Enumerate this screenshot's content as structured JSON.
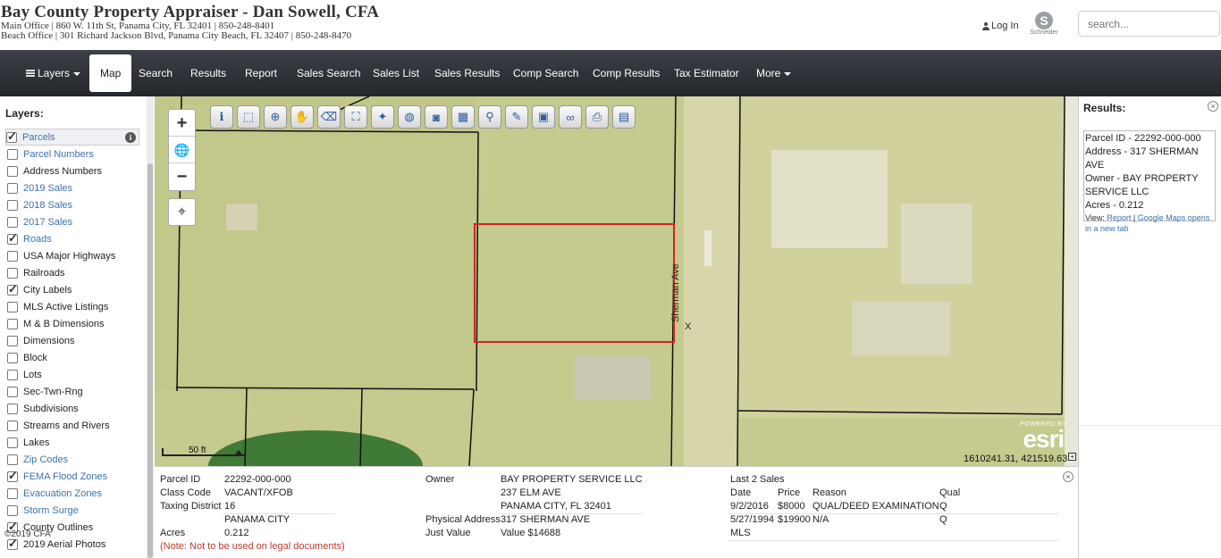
{
  "header": {
    "title": "Bay County Property Appraiser - Dan Sowell, CFA",
    "main_office": "Main Office | 860 W. 11th St, Panama City, FL 32401 | 850-248-8401",
    "beach_office": "Beach Office | 301 Richard Jackson Blvd, Panama City Beach, FL 32407 | 850-248-8470",
    "login_label": "Log In",
    "logo_letter": "S",
    "logo_text": "Schneider",
    "search_placeholder": "search..."
  },
  "nav": {
    "layers": "Layers",
    "map": "Map",
    "search": "Search",
    "results": "Results",
    "report": "Report",
    "sales_search": "Sales Search",
    "sales_list": "Sales List",
    "sales_results": "Sales Results",
    "comp_search": "Comp Search",
    "comp_results": "Comp Results",
    "tax_estimator": "Tax Estimator",
    "more": "More"
  },
  "layers_panel": {
    "title": "Layers:",
    "items": [
      {
        "label": "Parcels",
        "checked": true,
        "link": true
      },
      {
        "label": "Parcel Numbers",
        "checked": false,
        "link": true
      },
      {
        "label": "Address Numbers",
        "checked": false,
        "link": false
      },
      {
        "label": "2019 Sales",
        "checked": false,
        "link": true
      },
      {
        "label": "2018 Sales",
        "checked": false,
        "link": true
      },
      {
        "label": "2017 Sales",
        "checked": false,
        "link": true
      },
      {
        "label": "Roads",
        "checked": true,
        "link": true
      },
      {
        "label": "USA Major Highways",
        "checked": false,
        "link": false
      },
      {
        "label": "Railroads",
        "checked": false,
        "link": false
      },
      {
        "label": "City Labels",
        "checked": true,
        "link": false
      },
      {
        "label": "MLS Active Listings",
        "checked": false,
        "link": false
      },
      {
        "label": "M & B Dimensions",
        "checked": false,
        "link": false
      },
      {
        "label": "Dimensions",
        "checked": false,
        "link": false
      },
      {
        "label": "Block",
        "checked": false,
        "link": false
      },
      {
        "label": "Lots",
        "checked": false,
        "link": false
      },
      {
        "label": "Sec-Twn-Rng",
        "checked": false,
        "link": false
      },
      {
        "label": "Subdivisions",
        "checked": false,
        "link": false
      },
      {
        "label": "Streams and Rivers",
        "checked": false,
        "link": false
      },
      {
        "label": "Lakes",
        "checked": false,
        "link": false
      },
      {
        "label": "Zip Codes",
        "checked": false,
        "link": true
      },
      {
        "label": "FEMA Flood Zones",
        "checked": true,
        "link": true
      },
      {
        "label": "Evacuation Zones",
        "checked": false,
        "link": true
      },
      {
        "label": "Storm Surge",
        "checked": false,
        "link": true
      },
      {
        "label": "County Outlines",
        "checked": true,
        "link": false
      },
      {
        "label": "2019 Aerial Photos",
        "checked": true,
        "link": false
      }
    ],
    "info_glyph": "i",
    "copyright": "©2019 CFA"
  },
  "map": {
    "zoom_in": "+",
    "globe": "🌐",
    "zoom_out": "−",
    "locate": "⌖",
    "tools": [
      {
        "name": "identify-icon",
        "glyph": "ℹ"
      },
      {
        "name": "select-icon",
        "glyph": "⬚"
      },
      {
        "name": "zoom-window-icon",
        "glyph": "⊕"
      },
      {
        "name": "pan-icon",
        "glyph": "✋"
      },
      {
        "name": "eraser-icon",
        "glyph": "⌫"
      },
      {
        "name": "zoom-extent-icon",
        "glyph": "⛶"
      },
      {
        "name": "pin-icon",
        "glyph": "✦"
      },
      {
        "name": "globe-icon",
        "glyph": "◍"
      },
      {
        "name": "camera-icon",
        "glyph": "◙"
      },
      {
        "name": "buffer-icon",
        "glyph": "▦"
      },
      {
        "name": "find-icon",
        "glyph": "⚲"
      },
      {
        "name": "draw-icon",
        "glyph": "✎"
      },
      {
        "name": "print-map-icon",
        "glyph": "▣"
      },
      {
        "name": "binoculars-icon",
        "glyph": "∞"
      },
      {
        "name": "printer-icon",
        "glyph": "⎙"
      },
      {
        "name": "save-icon",
        "glyph": "▤"
      }
    ],
    "scale_label": "50 ft",
    "street": "Sherman Ave",
    "marker": "X",
    "coords": "1610241.31, 421519.63",
    "coord_expand": "+",
    "esri_powered": "POWERED BY",
    "esri_logo": "esri",
    "colors": {
      "selected_parcel": "#d8231f",
      "parcel_lines": "#111111",
      "imagery_tint": "#c9cd93"
    }
  },
  "results_panel": {
    "title": "Results:",
    "close": "×",
    "parcel_line": "Parcel ID - 22292-000-000",
    "address_line": "Address - 317 SHERMAN AVE",
    "owner_line_1": "Owner - BAY PROPERTY",
    "owner_line_2": "SERVICE LLC",
    "acres_line": "Acres - 0.212",
    "view_prefix": "View:",
    "report_link": "Report",
    "separator": "|",
    "google_link_1": "Google Maps opens",
    "google_link_2": "in a new tab"
  },
  "info_panel": {
    "close": "×",
    "parcel_id_label": "Parcel ID",
    "parcel_id": "22292-000-000",
    "class_code_label": "Class Code",
    "class_code": "VACANT/XFOB",
    "taxing_district_label": "Taxing District",
    "taxing_district": "16",
    "city": "PANAMA CITY",
    "acres_label": "Acres",
    "acres": "0.212",
    "note": "(Note: Not to be used on legal documents)",
    "owner_label": "Owner",
    "owner_name": "BAY PROPERTY SERVICE LLC",
    "owner_addr1": "237 ELM AVE",
    "owner_addr2": "PANAMA CITY, FL 32401",
    "physical_address_label": "Physical Address",
    "physical_address": "317 SHERMAN AVE",
    "just_value_label": "Just Value",
    "just_value": "Value $14688",
    "last_sales_label": "Last 2 Sales",
    "sales_headers": {
      "date": "Date",
      "price": "Price",
      "reason": "Reason",
      "qual": "Qual"
    },
    "sales": [
      {
        "date": "9/2/2016",
        "price": "$8000",
        "reason": "QUAL/DEED EXAMINATION",
        "qual": "Q"
      },
      {
        "date": "5/27/1994",
        "price": "$19900",
        "reason": "N/A",
        "qual": "Q"
      }
    ],
    "mls_label": "MLS"
  }
}
